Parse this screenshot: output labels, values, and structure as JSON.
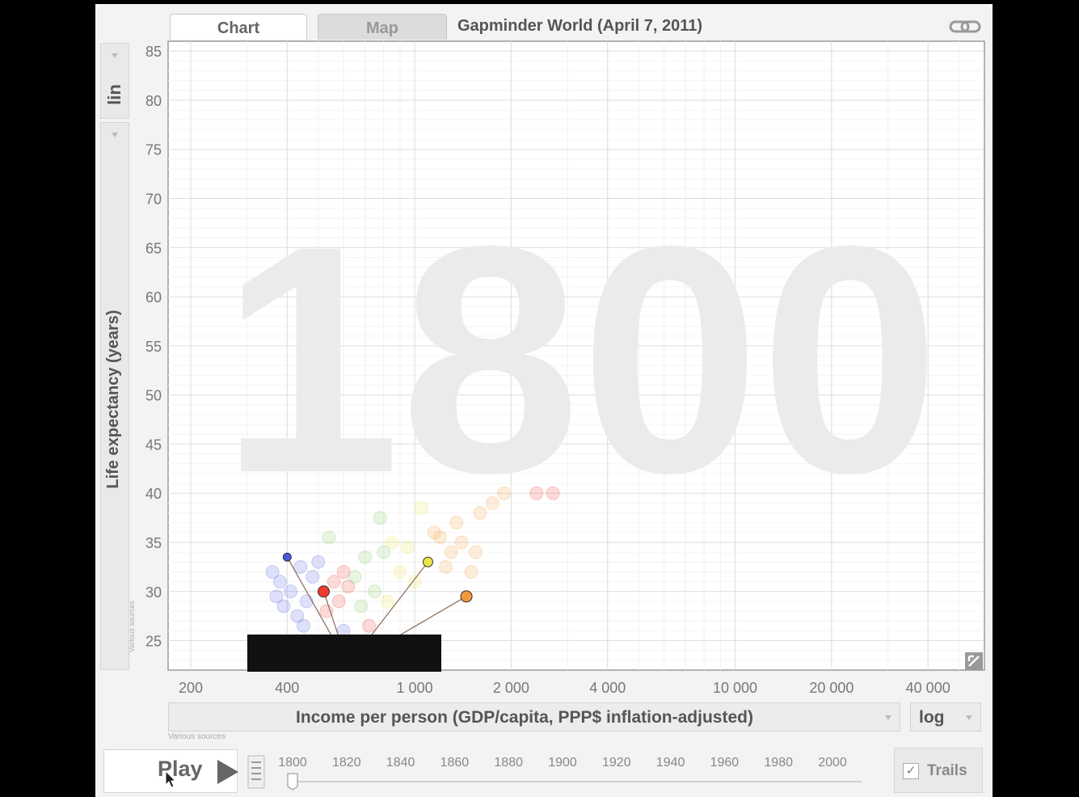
{
  "tabs": [
    {
      "label": "Chart",
      "active": true
    },
    {
      "label": "Map",
      "active": false
    }
  ],
  "title": "Gapminder World (April 7, 2011)",
  "y_scale": "lin",
  "x_scale": "log",
  "tiny_legend": "Various sources",
  "play_label": "Play",
  "trails_label": "Trails",
  "trails_checked": true,
  "current_year": 1800,
  "timeline_years": [
    "1800",
    "1820",
    "1840",
    "1860",
    "1880",
    "1900",
    "1920",
    "1940",
    "1960",
    "1980",
    "2000"
  ],
  "colors": {
    "blue": "#4a5be0",
    "red": "#f03a2e",
    "yellow": "#e8e64a",
    "orange": "#f29a3a"
  },
  "chart_data": {
    "type": "scatter",
    "title": "",
    "xlabel": "Income per person (GDP/capita, PPP$ inflation-adjusted)",
    "ylabel": "Life expectancy (years)",
    "xscale": "log",
    "xlim": [
      170,
      60000
    ],
    "ylim": [
      22,
      86
    ],
    "xticks": [
      {
        "value": 200,
        "label": "200"
      },
      {
        "value": 400,
        "label": "400"
      },
      {
        "value": 1000,
        "label": "1 000"
      },
      {
        "value": 2000,
        "label": "2 000"
      },
      {
        "value": 4000,
        "label": "4 000"
      },
      {
        "value": 10000,
        "label": "10 000"
      },
      {
        "value": 20000,
        "label": "20 000"
      },
      {
        "value": 40000,
        "label": "40 000"
      }
    ],
    "yticks": [
      25,
      30,
      35,
      40,
      45,
      50,
      55,
      60,
      65,
      70,
      75,
      80,
      85
    ],
    "grid": true,
    "watermark": "1800",
    "highlighted": [
      {
        "x": 400,
        "y": 33.5,
        "color": "#4a5be0",
        "r": 5
      },
      {
        "x": 520,
        "y": 30,
        "color": "#f03a2e",
        "r": 7
      },
      {
        "x": 1100,
        "y": 33,
        "color": "#e8e64a",
        "r": 6
      },
      {
        "x": 1450,
        "y": 29.5,
        "color": "#f29a3a",
        "r": 7
      }
    ],
    "background_points": [
      {
        "x": 360,
        "y": 32,
        "color": "#4a5be0"
      },
      {
        "x": 380,
        "y": 31,
        "color": "#4a5be0"
      },
      {
        "x": 410,
        "y": 30,
        "color": "#4a5be0"
      },
      {
        "x": 440,
        "y": 32.5,
        "color": "#4a5be0"
      },
      {
        "x": 460,
        "y": 29,
        "color": "#4a5be0"
      },
      {
        "x": 390,
        "y": 28.5,
        "color": "#4a5be0"
      },
      {
        "x": 430,
        "y": 27.5,
        "color": "#4a5be0"
      },
      {
        "x": 480,
        "y": 31.5,
        "color": "#4a5be0"
      },
      {
        "x": 370,
        "y": 29.5,
        "color": "#4a5be0"
      },
      {
        "x": 500,
        "y": 33,
        "color": "#4a5be0"
      },
      {
        "x": 450,
        "y": 26.5,
        "color": "#4a5be0"
      },
      {
        "x": 530,
        "y": 28,
        "color": "#f03a2e"
      },
      {
        "x": 560,
        "y": 31,
        "color": "#f03a2e"
      },
      {
        "x": 600,
        "y": 32,
        "color": "#f03a2e"
      },
      {
        "x": 580,
        "y": 29,
        "color": "#f03a2e"
      },
      {
        "x": 620,
        "y": 30.5,
        "color": "#f03a2e"
      },
      {
        "x": 700,
        "y": 33.5,
        "color": "#7ac55a"
      },
      {
        "x": 650,
        "y": 31.5,
        "color": "#7ac55a"
      },
      {
        "x": 750,
        "y": 30,
        "color": "#7ac55a"
      },
      {
        "x": 800,
        "y": 34,
        "color": "#7ac55a"
      },
      {
        "x": 680,
        "y": 28.5,
        "color": "#7ac55a"
      },
      {
        "x": 900,
        "y": 32,
        "color": "#e8e64a"
      },
      {
        "x": 950,
        "y": 34.5,
        "color": "#e8e64a"
      },
      {
        "x": 850,
        "y": 35,
        "color": "#e8e64a"
      },
      {
        "x": 1000,
        "y": 31,
        "color": "#e8e64a"
      },
      {
        "x": 1200,
        "y": 35.5,
        "color": "#f29a3a"
      },
      {
        "x": 1300,
        "y": 34,
        "color": "#f29a3a"
      },
      {
        "x": 1150,
        "y": 36,
        "color": "#f29a3a"
      },
      {
        "x": 1400,
        "y": 35,
        "color": "#f29a3a"
      },
      {
        "x": 1250,
        "y": 32.5,
        "color": "#f29a3a"
      },
      {
        "x": 1550,
        "y": 34,
        "color": "#f29a3a"
      },
      {
        "x": 1350,
        "y": 37,
        "color": "#f29a3a"
      },
      {
        "x": 1600,
        "y": 38,
        "color": "#f29a3a"
      },
      {
        "x": 1750,
        "y": 39,
        "color": "#f29a3a"
      },
      {
        "x": 1900,
        "y": 40,
        "color": "#f29a3a"
      },
      {
        "x": 2400,
        "y": 40,
        "color": "#f03a2e"
      },
      {
        "x": 2700,
        "y": 40,
        "color": "#f03a2e"
      },
      {
        "x": 1050,
        "y": 38.5,
        "color": "#e8e64a"
      },
      {
        "x": 780,
        "y": 37.5,
        "color": "#7ac55a"
      },
      {
        "x": 540,
        "y": 35.5,
        "color": "#7ac55a"
      },
      {
        "x": 600,
        "y": 26,
        "color": "#4a5be0"
      },
      {
        "x": 720,
        "y": 26.5,
        "color": "#f03a2e"
      },
      {
        "x": 820,
        "y": 29,
        "color": "#e8e64a"
      },
      {
        "x": 1500,
        "y": 32,
        "color": "#f29a3a"
      }
    ]
  }
}
